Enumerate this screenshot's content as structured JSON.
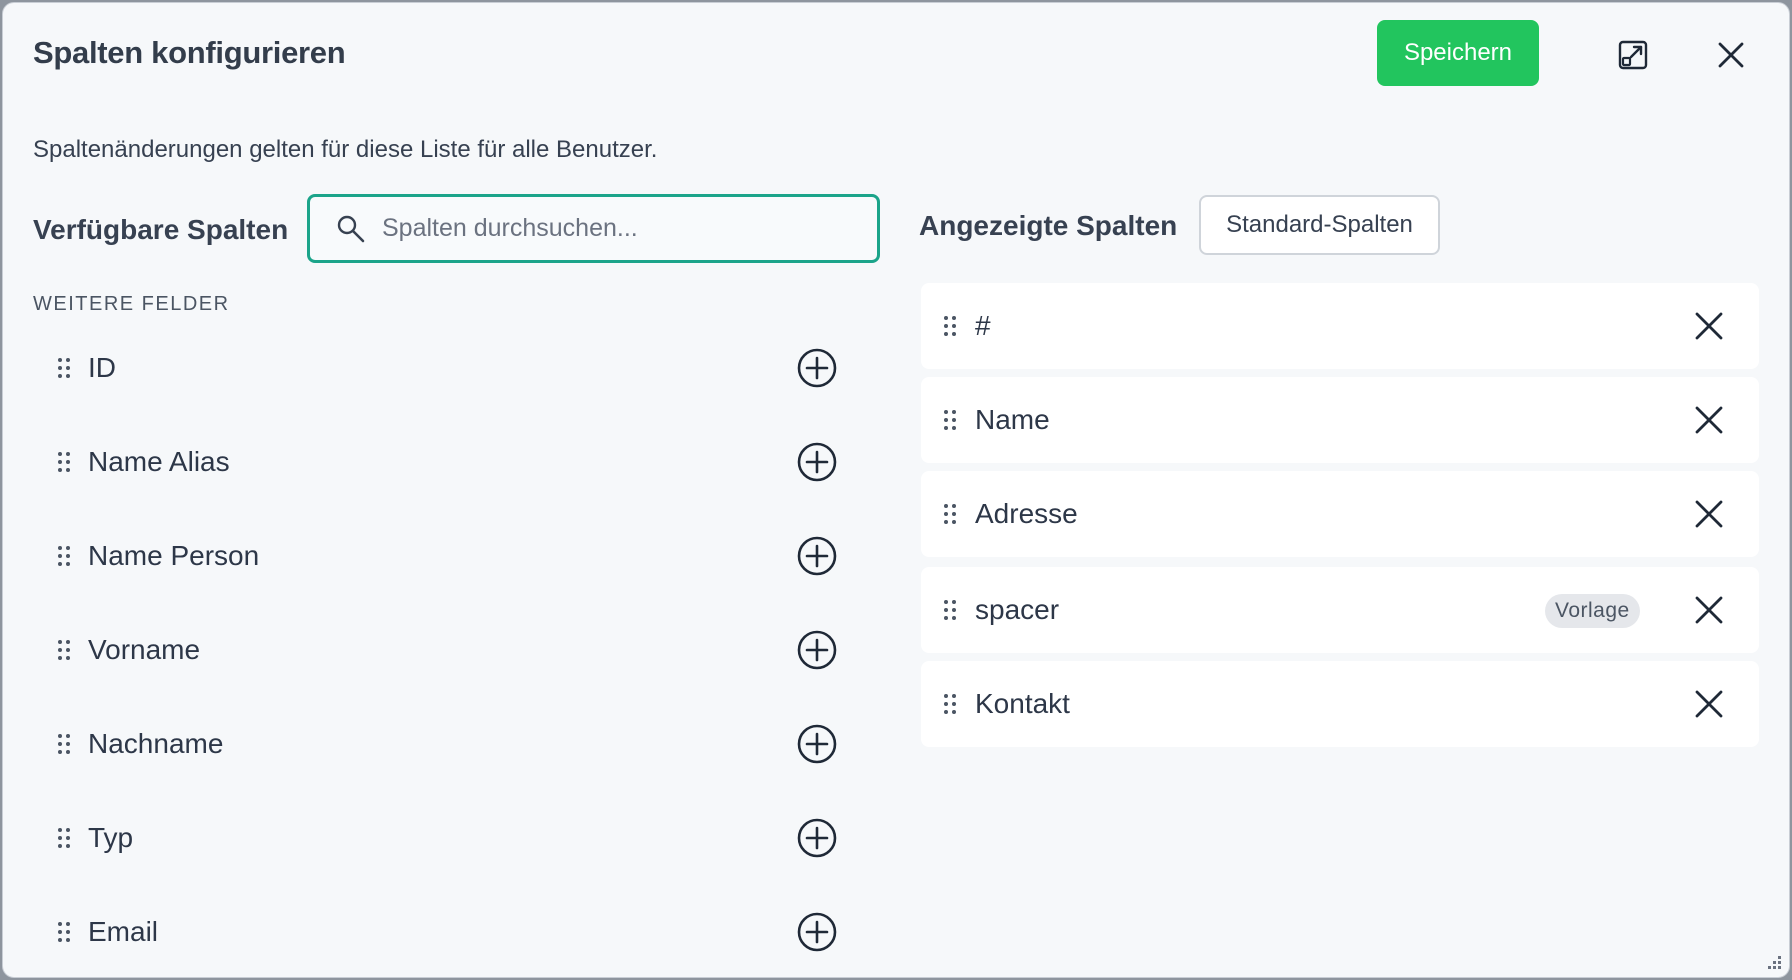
{
  "dialog": {
    "title": "Spalten konfigurieren",
    "save_label": "Speichern",
    "subtitle": "Spaltenänderungen gelten für diese Liste für alle Benutzer."
  },
  "available": {
    "heading": "Verfügbare Spalten",
    "search_placeholder": "Spalten durchsuchen...",
    "search_value": "",
    "group_label": "WEITERE FELDER",
    "items": [
      {
        "label": "ID"
      },
      {
        "label": "Name Alias"
      },
      {
        "label": "Name Person"
      },
      {
        "label": "Vorname"
      },
      {
        "label": "Nachname"
      },
      {
        "label": "Typ"
      },
      {
        "label": "Email"
      }
    ]
  },
  "displayed": {
    "heading": "Angezeigte Spalten",
    "default_button_label": "Standard-Spalten",
    "items": [
      {
        "label": "#",
        "badge": ""
      },
      {
        "label": "Name",
        "badge": ""
      },
      {
        "label": "Adresse",
        "badge": ""
      },
      {
        "label": "spacer",
        "badge": "Vorlage"
      },
      {
        "label": "Kontakt",
        "badge": ""
      }
    ]
  },
  "colors": {
    "accent": "#22c55e",
    "focus_border": "#1ba48a",
    "background": "#f6f8fa",
    "card": "#ffffff"
  },
  "icons": [
    "search-icon",
    "expand-icon",
    "close-icon",
    "drag-handle-icon",
    "plus-circle-icon",
    "remove-icon",
    "resize-grip-icon"
  ]
}
